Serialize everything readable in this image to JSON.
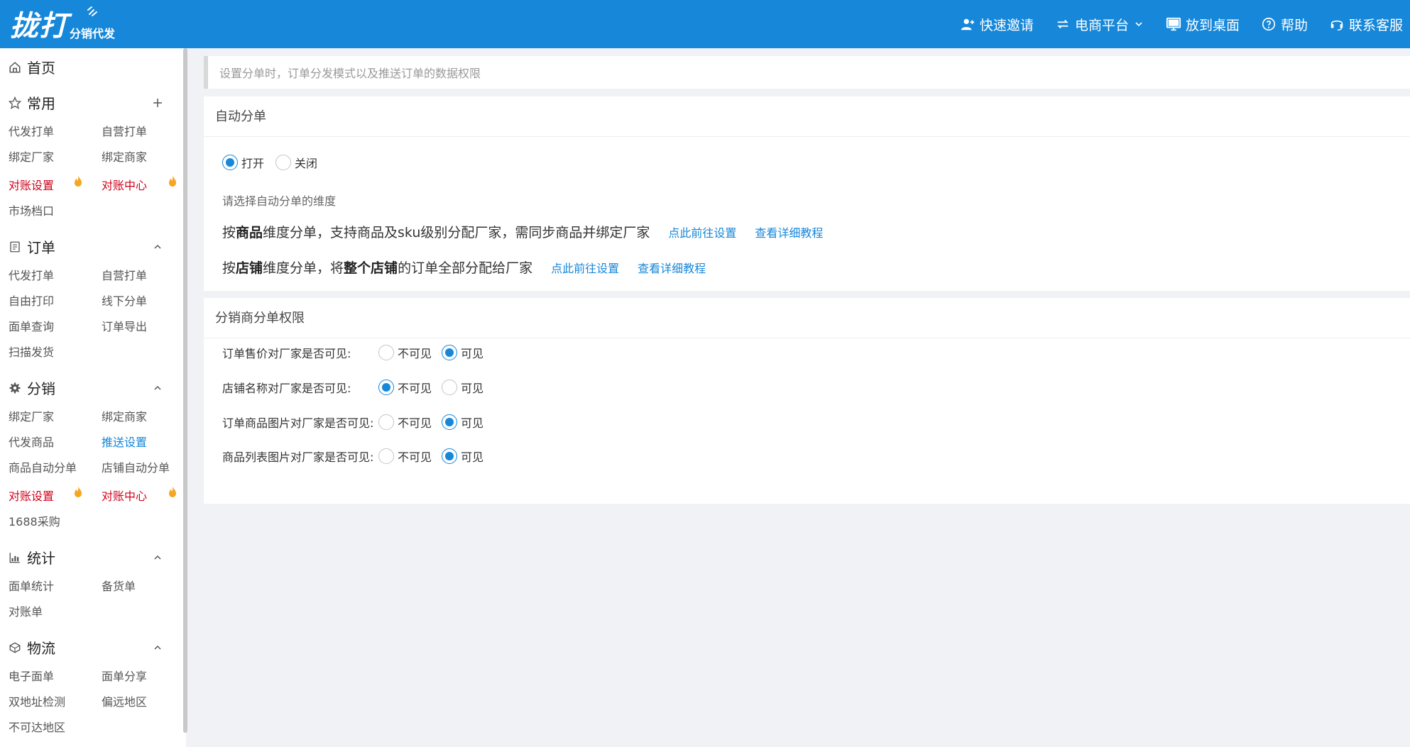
{
  "header": {
    "logo_main": "拢打",
    "logo_sub": "分销代发",
    "nav": {
      "invite": "快速邀请",
      "platform": "电商平台",
      "desktop": "放到桌面",
      "help": "帮助",
      "service": "联系客服"
    }
  },
  "sidebar": {
    "home": "首页",
    "common": {
      "title": "常用",
      "items": [
        "代发打单",
        "自营打单",
        "绑定厂家",
        "绑定商家",
        "对账设置",
        "对账中心",
        "市场档口"
      ]
    },
    "order": {
      "title": "订单",
      "items": [
        "代发打单",
        "自营打单",
        "自由打印",
        "线下分单",
        "面单查询",
        "订单导出",
        "扫描发货"
      ]
    },
    "distribution": {
      "title": "分销",
      "items": [
        "绑定厂家",
        "绑定商家",
        "代发商品",
        "推送设置",
        "商品自动分单",
        "店铺自动分单",
        "对账设置",
        "对账中心",
        "1688采购"
      ]
    },
    "stats": {
      "title": "统计",
      "items": [
        "面单统计",
        "备货单",
        "对账单"
      ]
    },
    "logistics": {
      "title": "物流",
      "items": [
        "电子面单",
        "面单分享",
        "双地址检测",
        "偏远地区",
        "不可达地区"
      ]
    }
  },
  "main": {
    "tip": "设置分单时，订单分发模式以及推送订单的数据权限",
    "auto_split": {
      "title": "自动分单",
      "open_label": "打开",
      "close_label": "关闭",
      "selected": "打开",
      "hint": "请选择自动分单的维度",
      "dim1": {
        "pre": "按",
        "bold1": "商品",
        "mid": "维度分单，支持商品及sku级别分配厂家，需同步商品并绑定厂家",
        "link1": "点此前往设置",
        "link2": "查看详细教程"
      },
      "dim2": {
        "pre": "按",
        "bold1": "店铺",
        "mid": "维度分单，将",
        "bold2": "整个店铺",
        "post": "的订单全部分配给厂家",
        "link1": "点此前往设置",
        "link2": "查看详细教程"
      }
    },
    "perm": {
      "title": "分销商分单权限",
      "invisible_label": "不可见",
      "visible_label": "可见",
      "rows": [
        {
          "label": "订单售价对厂家是否可见:",
          "value": "可见"
        },
        {
          "label": "店铺名称对厂家是否可见:",
          "value": "不可见"
        },
        {
          "label": "订单商品图片对厂家是否可见:",
          "value": "可见"
        },
        {
          "label": "商品列表图片对厂家是否可见:",
          "value": "可见"
        }
      ]
    }
  },
  "colors": {
    "brand": "#1687d9",
    "hot_red": "#d0021b",
    "fire": "#f5a623"
  }
}
